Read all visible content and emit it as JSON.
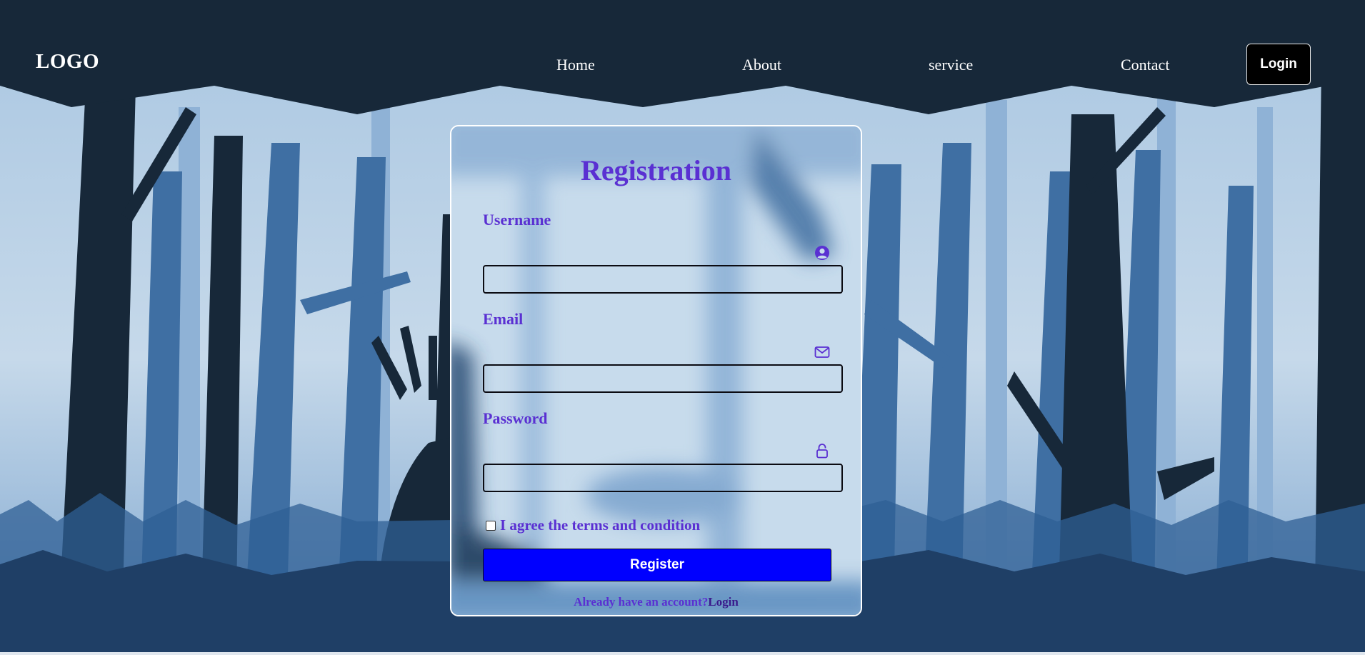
{
  "header": {
    "logo": "LOGO",
    "nav": [
      {
        "label": "Home"
      },
      {
        "label": "About"
      },
      {
        "label": "service"
      },
      {
        "label": "Contact"
      }
    ],
    "login_button": "Login"
  },
  "form": {
    "title": "Registration",
    "fields": [
      {
        "label": "Username",
        "icon": "user-circle-icon",
        "value": ""
      },
      {
        "label": "Email",
        "icon": "envelope-icon",
        "value": ""
      },
      {
        "label": "Password",
        "icon": "lock-icon",
        "value": ""
      }
    ],
    "agree_label": "I agree the terms and condition",
    "agree_checked": false,
    "register_button": "Register",
    "footer_text": "Already have an account?",
    "footer_link": "Login"
  },
  "colors": {
    "accent_text": "#5a30d2",
    "register_bg": "#0000ff",
    "page_dark": "#172839",
    "forest_mid": "#3f6fa3",
    "sky_light": "#c6d9ea"
  }
}
